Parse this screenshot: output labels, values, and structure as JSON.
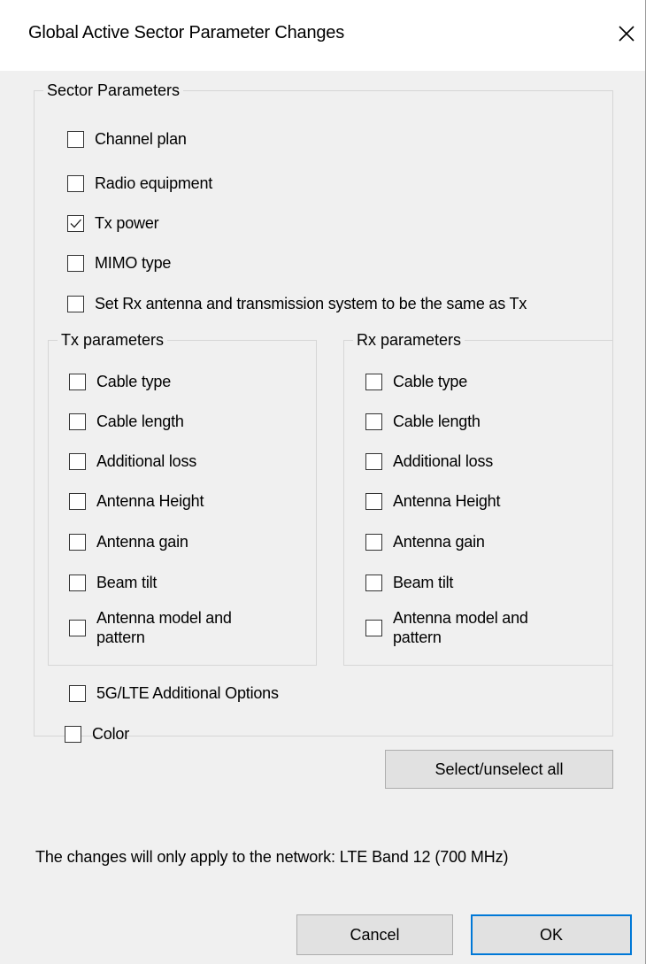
{
  "window": {
    "title": "Global Active Sector Parameter Changes",
    "close_icon": "close-icon"
  },
  "sector_parameters": {
    "legend": "Sector Parameters",
    "items": [
      {
        "label": "Channel plan",
        "checked": false
      },
      {
        "label": "Radio equipment",
        "checked": false
      },
      {
        "label": "Tx power",
        "checked": true
      },
      {
        "label": "MIMO type",
        "checked": false
      },
      {
        "label": "Set Rx antenna and transmission system to be the same as Tx",
        "checked": false
      }
    ]
  },
  "tx_parameters": {
    "legend": "Tx parameters",
    "items": [
      {
        "label": "Cable type",
        "checked": false
      },
      {
        "label": "Cable length",
        "checked": false
      },
      {
        "label": "Additional loss",
        "checked": false
      },
      {
        "label": "Antenna Height",
        "checked": false
      },
      {
        "label": "Antenna gain",
        "checked": false
      },
      {
        "label": "Beam tilt",
        "checked": false
      },
      {
        "label": "Antenna model and pattern",
        "checked": false
      }
    ]
  },
  "rx_parameters": {
    "legend": "Rx parameters",
    "items": [
      {
        "label": "Cable type",
        "checked": false
      },
      {
        "label": "Cable length",
        "checked": false
      },
      {
        "label": "Additional loss",
        "checked": false
      },
      {
        "label": "Antenna Height",
        "checked": false
      },
      {
        "label": "Antenna gain",
        "checked": false
      },
      {
        "label": "Beam tilt",
        "checked": false
      },
      {
        "label": "Antenna model and pattern",
        "checked": false
      }
    ]
  },
  "options": {
    "lte_options": {
      "label": "5G/LTE Additional Options",
      "checked": false
    },
    "color": {
      "label": "Color",
      "checked": false
    }
  },
  "buttons": {
    "select_all": "Select/unselect all",
    "cancel": "Cancel",
    "ok": "OK"
  },
  "note": "The changes will only apply to the network: LTE Band 12 (700 MHz)"
}
